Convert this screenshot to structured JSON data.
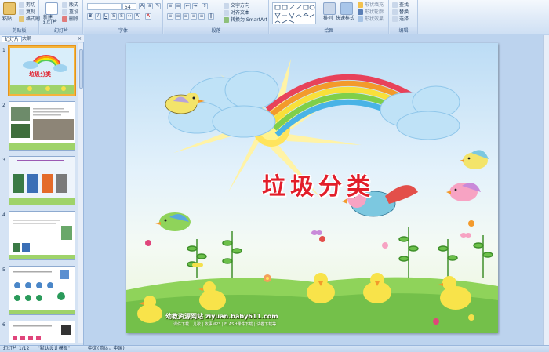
{
  "ribbon": {
    "clipboard": {
      "paste_label": "粘贴",
      "cut_label": "剪切",
      "copy_label": "复制",
      "format_painter_label": "格式刷",
      "title": "剪贴板"
    },
    "slides": {
      "new_slide_label": "新建\n幻灯片",
      "layout_label": "版式",
      "reset_label": "重设",
      "delete_label": "删除",
      "title": "幻灯片"
    },
    "font": {
      "font_name": "",
      "font_size": "54",
      "title": "字体"
    },
    "paragraph": {
      "text_direction_label": "文字方向",
      "align_text_label": "对齐文本",
      "smartart_label": "转换为 SmartArt",
      "title": "段落"
    },
    "drawing": {
      "arrange_label": "排列",
      "quick_styles_label": "快速样式",
      "shape_fill_label": "形状填充",
      "shape_outline_label": "形状轮廓",
      "shape_effects_label": "形状效果",
      "title": "绘图"
    },
    "editing": {
      "find_label": "查找",
      "replace_label": "替换",
      "select_label": "选择",
      "title": "编辑"
    }
  },
  "left_panel": {
    "tab_slides": "幻灯片",
    "tab_outline": "大纲",
    "close_glyph": "×",
    "thumb_title": "垃圾分类",
    "thumbnails": [
      {
        "number": "1"
      },
      {
        "number": "2"
      },
      {
        "number": "3"
      },
      {
        "number": "4"
      },
      {
        "number": "5"
      },
      {
        "number": "6"
      }
    ]
  },
  "slide": {
    "title": "垃圾分类",
    "footer_line1": "幼教资源网站 ziyuan.baby611.com",
    "footer_line2": "课件下载 | 儿歌 | 故事MP3 | FLASH课件下载 | 试卷下载等"
  },
  "status_bar": {
    "slide_counter": "幻灯片 1/12",
    "theme": "\"默认设计模板\"",
    "language": "中文(简体，中国)"
  },
  "colors": {
    "title_red": "#e21e2a",
    "ribbon_bg": "#dde9f7",
    "selected_thumb_border": "#f5b33a"
  }
}
